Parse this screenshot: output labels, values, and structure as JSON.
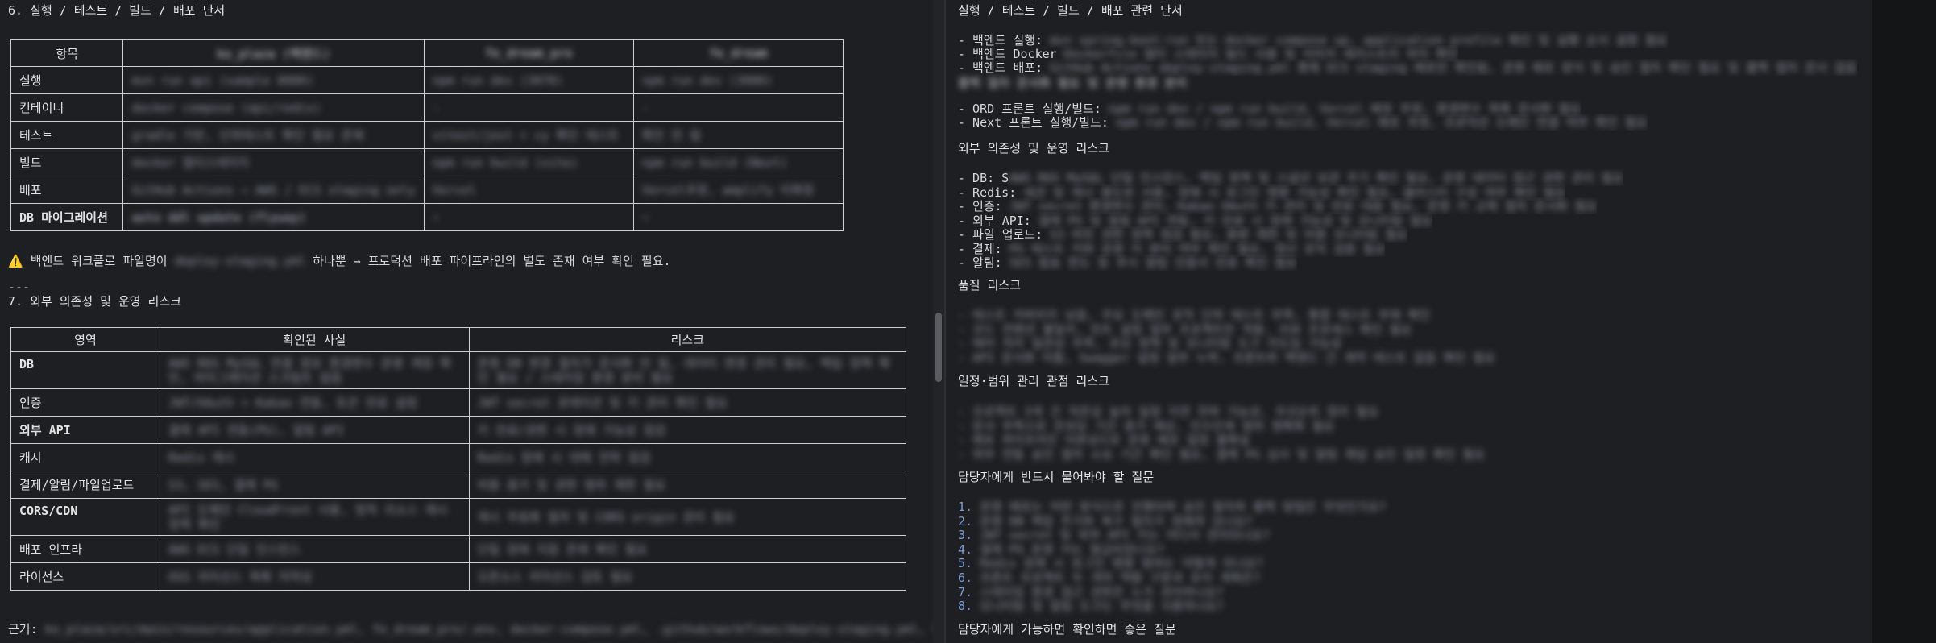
{
  "left": {
    "section6_title": "6. 실행 / 테스트 / 빌드 / 배포 단서",
    "table1": {
      "headers": [
        "항목",
        "ko_plaza (백엔드)",
        "fe_dream_pro",
        "fe_dream"
      ],
      "rows": [
        [
          "실행",
          "mvn run api (sample 8080)",
          "npm run dev (3070)",
          "npm run dev (3000)"
        ],
        [
          "컨테이너",
          "docker compose (api/redis)",
          "-",
          "-"
        ],
        [
          "테스트",
          "gradle 기반, 단위테스트 확인 필요 존재",
          "vitest/jest + cy 확인 테스트",
          "확인 안 됨"
        ],
        [
          "빌드",
          "docker 멀티스테이지",
          "npm run build (vite)",
          "npm run build (Next)"
        ],
        [
          "배포",
          "GitHub Actions → AWS / ECS staging only",
          "Vercel",
          "Vercel추정, amplify 미확정"
        ],
        [
          "DB 마이그레이션",
          "auto ddl update (flyway)",
          "-",
          "-"
        ]
      ]
    },
    "warning_prefix": "백엔드 워크플로 파일명이",
    "warning_code": "deploy-staging.yml",
    "warning_suffix": "하나뿐 → 프로덕션 배포 파이프라인의 별도 존재 여부 확인 필요.",
    "separator": "---",
    "section7_title": "7. 외부 의존성 및 운영 리스크",
    "table2": {
      "headers": [
        "영역",
        "확인된 사실",
        "리스크"
      ],
      "rows": [
        [
          "DB",
          "AWS RDS MySQL 연결 정보 환경변수 운영 계정 확인, 마이그레이션 스크립트 없음",
          "운영 DB 변경 절차가 문서화 안 됨, 데이터 변경 관리 필요, 백업 정책 확인 필요 / 스테이징 환경 분리 필요"
        ],
        [
          "인증",
          "JWT/OAuth + Kakao 연동, 토큰 만료 설정",
          "JWT secret 로테이션 및 키 관리 확인 필요"
        ],
        [
          "외부 API",
          "결제 API 연동(PG), 알림 API",
          "키 만료/권한 시 장애 가능성 점검"
        ],
        [
          "캐시",
          "Redis 캐시",
          "Redis 장애 시 대체 전략 점검"
        ],
        [
          "결제/알림/파일업로드",
          "S3, SES, 결제 PG",
          "비용 증가 및 권한 범위 제한 필요"
        ],
        [
          "CORS/CDN",
          "API 도메인 CloudFront 사용, 정적 리소스 캐시 정책 확인",
          "캐시 무효화 절차 및 CORS origin 관리 필요"
        ],
        [
          "배포 인프라",
          "AWS ECS 단일 인스턴스",
          "단일 장애 지점 존재 확인 필요"
        ],
        [
          "라이선스",
          "OSS 라이선스 목록 미작성",
          "오픈소스 라이선스 검토 필요"
        ]
      ]
    },
    "evidence_label": "근거:",
    "evidence_text": "ko_plaza/src/main/resources/application.yml, fe_dream_pro/.env, docker-compose.yml, .github/workflows/deploy-staging.yml, fe_dream/package.json"
  },
  "right": {
    "title": "실행 / 테스트 / 빌드 / 배포 관련 단서",
    "run_lines": [
      {
        "label": "- 백엔드 실행: ",
        "text": "mvn spring-boot:run 또는 docker compose up, application profile 확인 및 실행 순서 설명 필요"
      },
      {
        "label": "- 백엔드 Docker ",
        "text": "Dockerfile 멀티 스테이지 빌드 사용 및 이미지 레지스트리 위치 확인"
      },
      {
        "label": "- 백엔드 배포: ",
        "text": "GitHub Actions deploy-staging.yml 통해 ECS staging 배포만 확인됨, 운영 배포 방식 및 승인 절차 확인 필요 및 롤백 절차 문서 없음"
      }
    ],
    "run_wrap": "롤백 절차 문서화 필요 및 운영 환경 분리",
    "fe_lines": [
      {
        "label": "- ORD 프론트 실행/빌드: ",
        "text": "npm run dev / npm run build, Vercel 배포 추정, 환경변수 목록 문서화 필요"
      },
      {
        "label": "- Next 프론트 실행/빌드: ",
        "text": "npm run dev / npm run build, Vercel 배포 추정, 프로덕션 도메인 연결 여부 확인 필요"
      }
    ],
    "ext_title": "외부 의존성 및 운영 리스크",
    "ext_lines": [
      {
        "label": "- DB: S",
        "text": "AWS RDS MySQL 단일 인스턴스, 백업 정책 및 스냅샷 보관 주기 확인 필요, 운영 데이터 접근 권한 관리 필요"
      },
      {
        "label": "- Redis: ",
        "text": "세션 및 캐시 용도로 사용, 장애 시 로그인 영향 가능성 확인 필요, 클러스터 구성 여부 확인 필요"
      },
      {
        "label": "- 인증: ",
        "text": "JWT secret 환경변수 관리, Kakao OAuth 키 관리 및 만료 대응 필요, 운영 키 교체 절차 문서화 필요"
      },
      {
        "label": "- 외부 API: ",
        "text": "결제 PG 및 알림 API 연동, 키 만료 시 장애 가능성 및 모니터링 필요"
      },
      {
        "label": "- 파일 업로드: ",
        "text": "S3 버킷 권한 정책 점검 필요, 용량 제한 및 비용 모니터링 필요"
      },
      {
        "label": "- 결제: ",
        "text": "PG 테스트 키와 운영 키 분리 여부 확인 필요, 정산 로직 검증 필요"
      },
      {
        "label": "- 알림: ",
        "text": "SES 발송 한도 및 푸시 알림 인증서 만료 확인 필요"
      }
    ],
    "quality_title": "품질 리스크",
    "quality_lines": [
      "- 테스트 커버리지 낮음, 주요 도메인 로직 단위 테스트 부족, 통합 테스트 부재 확인",
      "- 코드 컨벤션 불일치, 린트 설정 일부 프로젝트만 적용, 리뷰 프로세스 확인 필요",
      "- 에러 처리 일관성 부족, 로깅 정책 및 모니터링 도구 미도입 가능성",
      "- API 문서화 미흡, Swagger 설정 일부 누락, 프론트와 백엔드 간 계약 테스트 없음 확인 필요"
    ],
    "schedule_title": "일정·범위 관리 관점 리스크",
    "schedule_lines": [
      "- 프로젝트 3개 간 의존성 높아 일정 지연 전파 가능성, 우선순위 정리 필요",
      "- 문서 부족으로 온보딩 기간 증가 예상, 인수인계 범위 명확화 필요",
      "- 배포 파이프라인 미완성으로 운영 배포 일정 불확실",
      "- 외부 연동 승인 절차 소요 기간 확인 필요, 결제 PG 심사 및 알림 채널 승인 일정 확인 필요"
    ],
    "must_title": "담당자에게 반드시 물어봐야 할 질문",
    "must_questions": [
      "운영 배포는 어떤 방식으로 진행되며 승인 절차와 롤백 방법은 무엇인가요?",
      "운영 DB 백업 주기와 복구 절차가 정해져 있나요?",
      "JWT secret 및 외부 API 키는 어디서 관리되나요?",
      "결제 PG 운영 키는 발급되었나요?",
      "Redis 장애 시 로그인 영향 범위는 어떻게 되나요?",
      "프론트 프로젝트 두 개의 역할 구분과 유지 계획은?",
      "스테이징 환경 접근 권한은 누가 관리하나요?",
      "모니터링 및 알림 도구는 무엇을 사용하나요?"
    ],
    "nice_title": "담당자에게 가능하면 확인하면 좋은 질문"
  }
}
